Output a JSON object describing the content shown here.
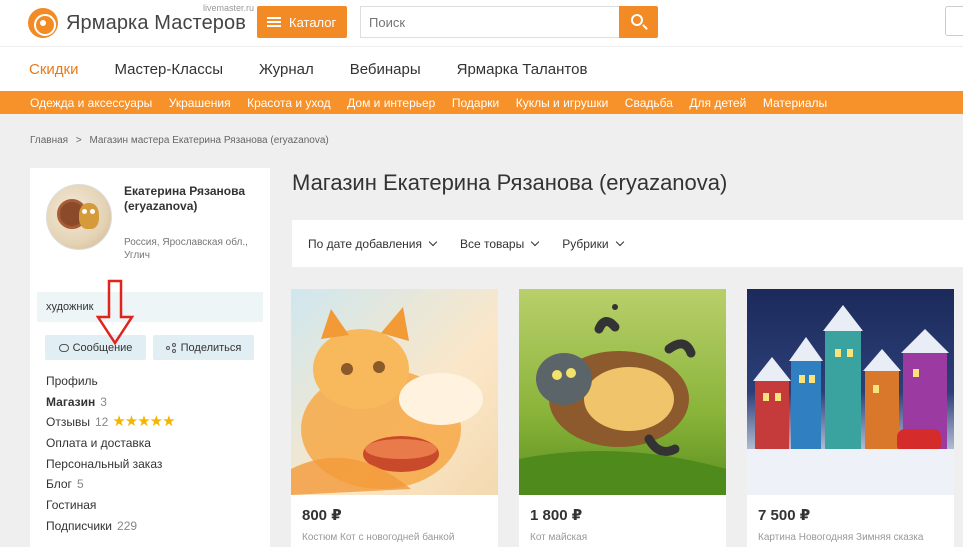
{
  "header": {
    "logo_text": "Ярмарка Мастеров",
    "logo_sub": "livemaster.ru",
    "catalog_label": "Каталог",
    "search_placeholder": "Поиск"
  },
  "nav": [
    "Скидки",
    "Мастер-Классы",
    "Журнал",
    "Вебинары",
    "Ярмарка Талантов"
  ],
  "categories": [
    "Одежда и аксессуары",
    "Украшения",
    "Красота и уход",
    "Дом и интерьер",
    "Подарки",
    "Куклы и игрушки",
    "Свадьба",
    "Для детей",
    "Материалы"
  ],
  "breadcrumb": {
    "home": "Главная",
    "sep": ">",
    "current": "Магазин мастера Екатерина Рязанова (eryazanova)"
  },
  "seller": {
    "name": "Екатерина Рязанова (eryazanova)",
    "location": "Россия, Ярославская обл., Углич",
    "bio": "художник",
    "message_label": "Сообщение",
    "share_label": "Поделиться"
  },
  "menu": [
    {
      "label": "Профиль",
      "count": ""
    },
    {
      "label": "Магазин",
      "count": "3"
    },
    {
      "label": "Отзывы",
      "count": "12"
    },
    {
      "label": "Оплата и доставка",
      "count": ""
    },
    {
      "label": "Персональный заказ",
      "count": ""
    },
    {
      "label": "Блог",
      "count": "5"
    },
    {
      "label": "Гостиная",
      "count": ""
    },
    {
      "label": "Подписчики",
      "count": "229"
    }
  ],
  "rating_stars": "★★★★★",
  "shop": {
    "title": "Магазин Екатерина Рязанова (eryazanova)",
    "filters": [
      "По дате добавления",
      "Все товары",
      "Рубрики"
    ]
  },
  "products": [
    {
      "price": "800 ₽",
      "name": "Костюм Кот с новогодней банкой"
    },
    {
      "price": "1 800 ₽",
      "name": "Кот майская"
    },
    {
      "price": "7 500 ₽",
      "name": "Картина Новогодняя Зимняя сказка"
    }
  ],
  "colors": {
    "accent": "#f28a25",
    "catbar": "#f7922b",
    "active_nav": "#e87a19",
    "arrow": "#e0241c",
    "star": "#f5b400"
  }
}
